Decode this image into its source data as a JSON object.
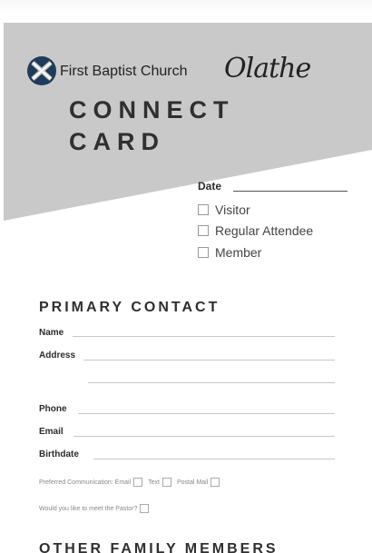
{
  "header": {
    "church_name": "First Baptist Church",
    "city_script": "Olathe",
    "title_line1": "CONNECT",
    "title_line2": "CARD"
  },
  "visit": {
    "date_label": "Date",
    "options": [
      "Visitor",
      "Regular Attendee",
      "Member"
    ]
  },
  "primary_contact": {
    "heading": "PRIMARY CONTACT",
    "fields": {
      "name": "Name",
      "address": "Address",
      "phone": "Phone",
      "email": "Email",
      "birthdate": "Birthdate"
    },
    "preferred_label": "Preferred Communication: Email",
    "preferred_text": "Text",
    "preferred_mail": "Postal Mail",
    "meet_pastor": "Would you like to meet the Pastor?"
  },
  "other_family": {
    "heading": "OTHER FAMILY MEMBERS"
  },
  "colors": {
    "header_gray": "#c9c9c9",
    "logo_blue": "#1f3b5a",
    "text_dark": "#2b2b2b"
  }
}
